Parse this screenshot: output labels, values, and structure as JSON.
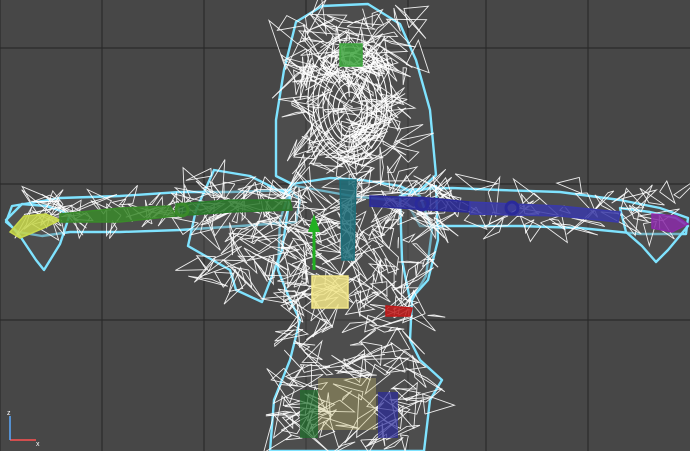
{
  "viewport": {
    "name": "front-viewport",
    "background": "#474747",
    "grid_color": "#2b2b2b",
    "wire_color": "#ffffff",
    "outline_color": "#7fe3ff",
    "selection_color": "#3fb0d8"
  },
  "axis_gizmo": {
    "x_label": "x",
    "z_label": "z",
    "x_color": "#ff5050",
    "z_color": "#5aa8ff"
  },
  "bones": [
    {
      "name": "left-hand-bone",
      "color": "#c8d84a"
    },
    {
      "name": "left-forearm-bone",
      "color": "#3a8a2a"
    },
    {
      "name": "left-upperarm-bone",
      "color": "#2a7a2a"
    },
    {
      "name": "spine-bone",
      "color": "#1e6f7a"
    },
    {
      "name": "pelvis-bone",
      "color": "#f2e688"
    },
    {
      "name": "right-upperarm-bone",
      "color": "#2a2a9a"
    },
    {
      "name": "right-forearm-bone",
      "color": "#3a3aa8"
    },
    {
      "name": "right-hand-bone",
      "color": "#8a2aa8"
    },
    {
      "name": "head-bone",
      "color": "#3fa63f"
    },
    {
      "name": "hip-bone",
      "color": "#c01a1a"
    }
  ]
}
